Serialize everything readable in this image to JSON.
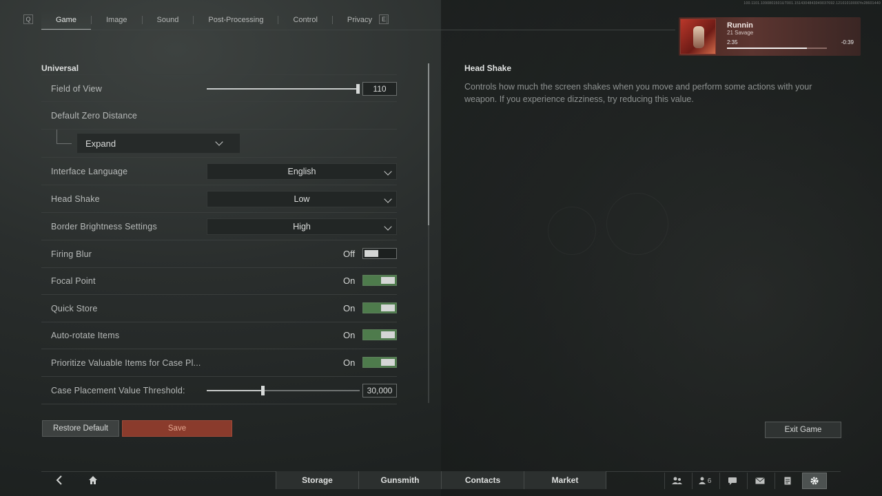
{
  "tabs": {
    "left_key": "Q",
    "right_key": "E",
    "items": [
      "Game",
      "Image",
      "Sound",
      "Post-Processing",
      "Control",
      "Privacy"
    ]
  },
  "music": {
    "title": "Runnin",
    "artist": "21 Savage",
    "elapsed": "2:35",
    "remaining": "-0:39",
    "progress_fraction": 0.8
  },
  "version": "100.1101.1090801501UT001.1514304843049037692.12101010000Ye28601440",
  "section": "Universal",
  "settings": {
    "fov": {
      "label": "Field of View",
      "value": "110",
      "fraction": 1.0
    },
    "zero": {
      "label": "Default Zero Distance",
      "expand": "Expand"
    },
    "language": {
      "label": "Interface Language",
      "value": "English"
    },
    "headshake": {
      "label": "Head Shake",
      "value": "Low"
    },
    "border": {
      "label": "Border Brightness Settings",
      "value": "High"
    },
    "firing_blur": {
      "label": "Firing Blur",
      "state": "Off"
    },
    "focal": {
      "label": "Focal Point",
      "state": "On"
    },
    "quick_store": {
      "label": "Quick Store",
      "state": "On"
    },
    "auto_rotate": {
      "label": "Auto-rotate Items",
      "state": "On"
    },
    "prioritize": {
      "label": "Prioritize Valuable Items for Case Pl...",
      "state": "On"
    },
    "threshold": {
      "label": "Case Placement Value Threshold:",
      "value": "30,000",
      "fraction": 0.37
    }
  },
  "buttons": {
    "restore": "Restore Default",
    "save": "Save",
    "exit": "Exit Game"
  },
  "description": {
    "title": "Head Shake",
    "text": "Controls how much the screen shakes when you move and perform some actions with your weapon. If you experience dizziness, try reducing this value."
  },
  "bottom_nav": {
    "tabs": [
      "Storage",
      "Gunsmith",
      "Contacts",
      "Market"
    ],
    "friends_count": "6"
  },
  "colors": {
    "accent_save": "#8a3b2c",
    "toggle_on": "#4e7b4c"
  }
}
